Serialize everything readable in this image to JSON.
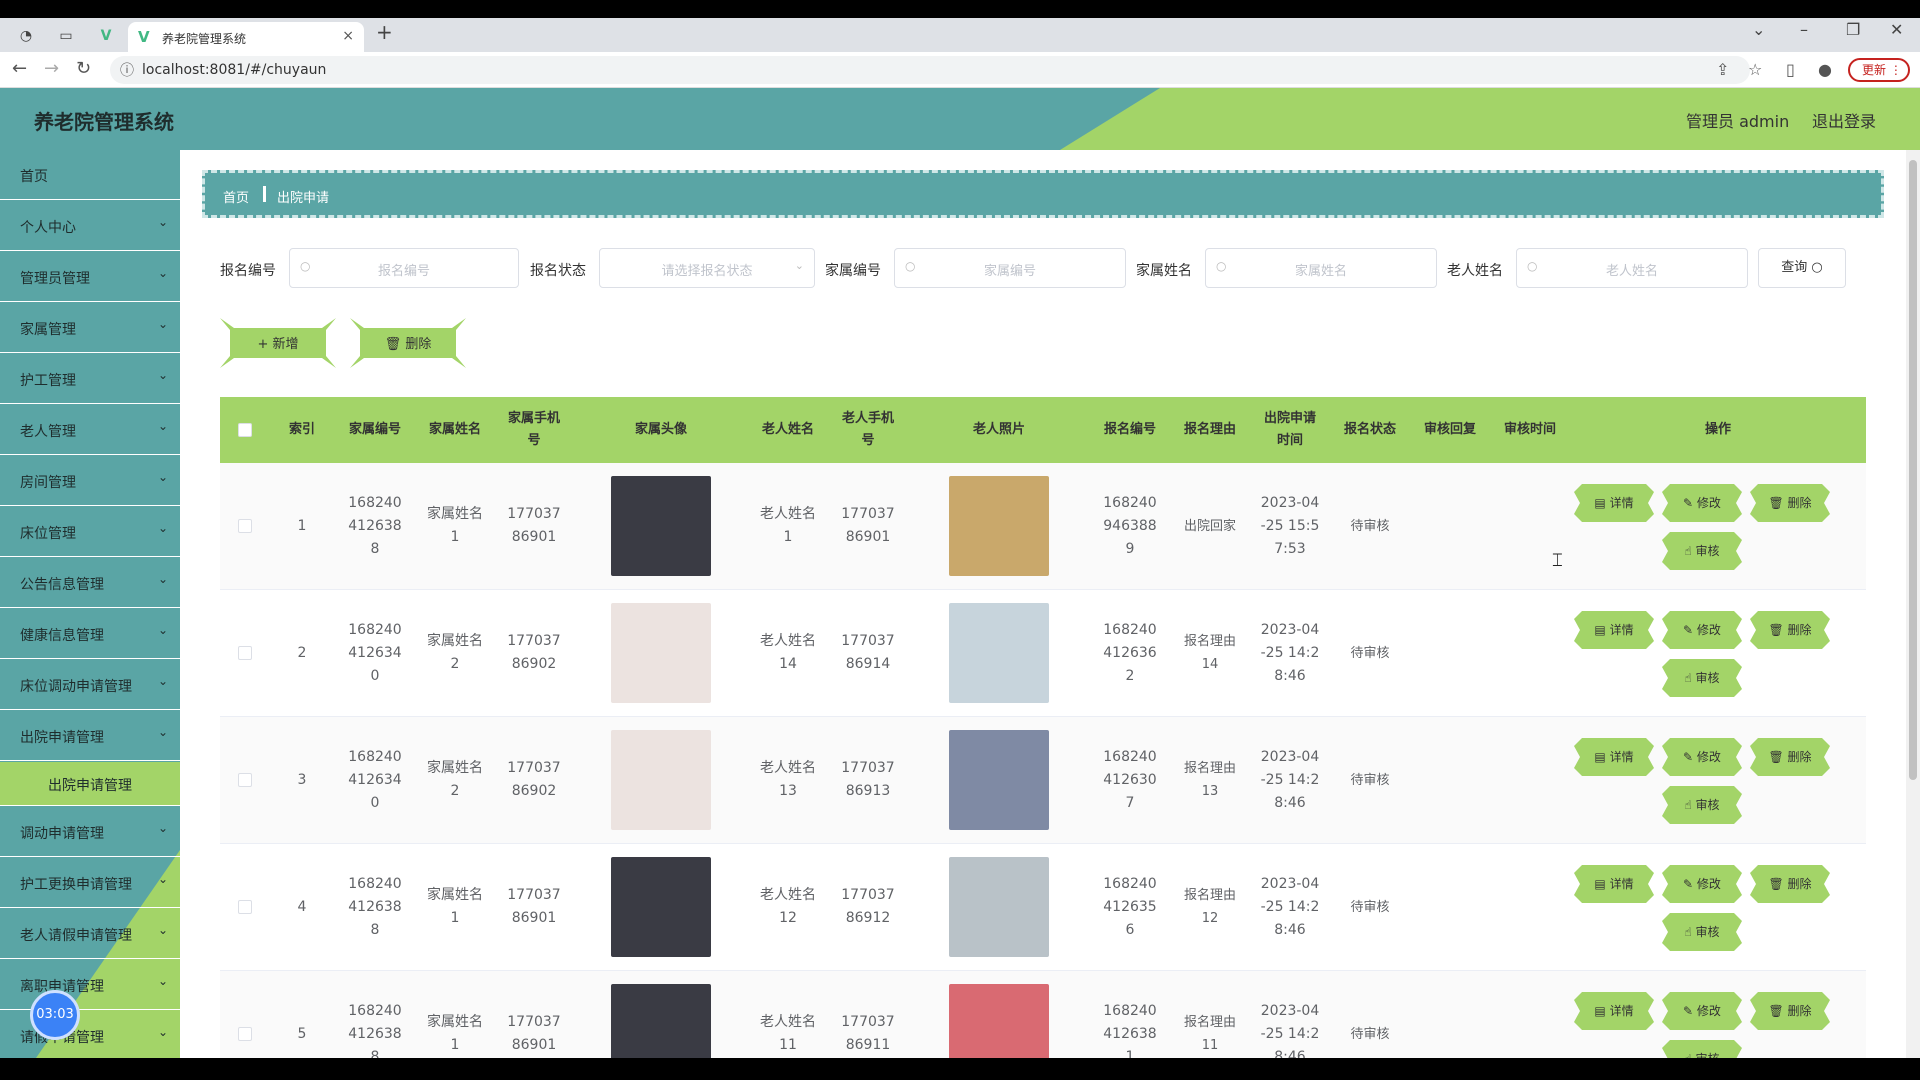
{
  "browser": {
    "tab_title": "养老院管理系统",
    "url": "localhost:8081/#/chuyaun",
    "update_label": "更新"
  },
  "header": {
    "title": "养老院管理系统",
    "admin": "管理员 admin",
    "logout": "退出登录"
  },
  "sidebar": {
    "items": [
      {
        "label": "首页"
      },
      {
        "label": "个人中心"
      },
      {
        "label": "管理员管理"
      },
      {
        "label": "家属管理"
      },
      {
        "label": "护工管理"
      },
      {
        "label": "老人管理"
      },
      {
        "label": "房间管理"
      },
      {
        "label": "床位管理"
      },
      {
        "label": "公告信息管理"
      },
      {
        "label": "健康信息管理"
      },
      {
        "label": "床位调动申请管理"
      },
      {
        "label": "出院申请管理"
      },
      {
        "label": "调动申请管理"
      },
      {
        "label": "护工更换申请管理"
      },
      {
        "label": "老人请假申请管理"
      },
      {
        "label": "离职申请管理"
      },
      {
        "label": "请假申请管理"
      }
    ],
    "active_sub": "出院申请管理",
    "timer": "03:03"
  },
  "breadcrumb": {
    "home": "首页",
    "current": "出院申请"
  },
  "filters": {
    "f1_label": "报名编号",
    "f1_ph": "报名编号",
    "f2_label": "报名状态",
    "f2_ph": "请选择报名状态",
    "f3_label": "家属编号",
    "f3_ph": "家属编号",
    "f4_label": "家属姓名",
    "f4_ph": "家属姓名",
    "f5_label": "老人姓名",
    "f5_ph": "老人姓名",
    "search": "查询"
  },
  "actions": {
    "add": "+ 新增",
    "delete": "删除"
  },
  "table": {
    "headers": {
      "index": "索引",
      "family_no": "家属编号",
      "family_name": "家属姓名",
      "family_phone": "家属手机号",
      "family_avatar": "家属头像",
      "elder_name": "老人姓名",
      "elder_phone": "老人手机号",
      "elder_photo": "老人照片",
      "reg_no": "报名编号",
      "reason": "报名理由",
      "apply_time": "出院申请时间",
      "status": "报名状态",
      "reply": "审核回复",
      "review_time": "审核时间",
      "ops": "操作"
    },
    "rows": [
      {
        "index": "1",
        "family_no": "1682404126388",
        "family_name": "家属姓名1",
        "family_phone": "17703786901",
        "elder_name": "老人姓名1",
        "elder_phone": "17703786901",
        "reg_no": "1682409463889",
        "reason": "出院回家",
        "time": "2023-04-25 15:57:53",
        "status": "待审核"
      },
      {
        "index": "2",
        "family_no": "1682404126340",
        "family_name": "家属姓名2",
        "family_phone": "17703786902",
        "elder_name": "老人姓名14",
        "elder_phone": "17703786914",
        "reg_no": "1682404126362",
        "reason": "报名理由14",
        "time": "2023-04-25 14:28:46",
        "status": "待审核"
      },
      {
        "index": "3",
        "family_no": "1682404126340",
        "family_name": "家属姓名2",
        "family_phone": "17703786902",
        "elder_name": "老人姓名13",
        "elder_phone": "17703786913",
        "reg_no": "1682404126307",
        "reason": "报名理由13",
        "time": "2023-04-25 14:28:46",
        "status": "待审核"
      },
      {
        "index": "4",
        "family_no": "1682404126388",
        "family_name": "家属姓名1",
        "family_phone": "17703786901",
        "elder_name": "老人姓名12",
        "elder_phone": "17703786912",
        "reg_no": "1682404126356",
        "reason": "报名理由12",
        "time": "2023-04-25 14:28:46",
        "status": "待审核"
      },
      {
        "index": "5",
        "family_no": "1682404126388",
        "family_name": "家属姓名1",
        "family_phone": "17703786901",
        "elder_name": "老人姓名11",
        "elder_phone": "17703786911",
        "reg_no": "1682404126381",
        "reason": "报名理由11",
        "time": "2023-04-25 14:28:46",
        "status": "待审核"
      }
    ],
    "op_detail": "详情",
    "op_edit": "修改",
    "op_delete": "删除",
    "op_review": "审核"
  }
}
